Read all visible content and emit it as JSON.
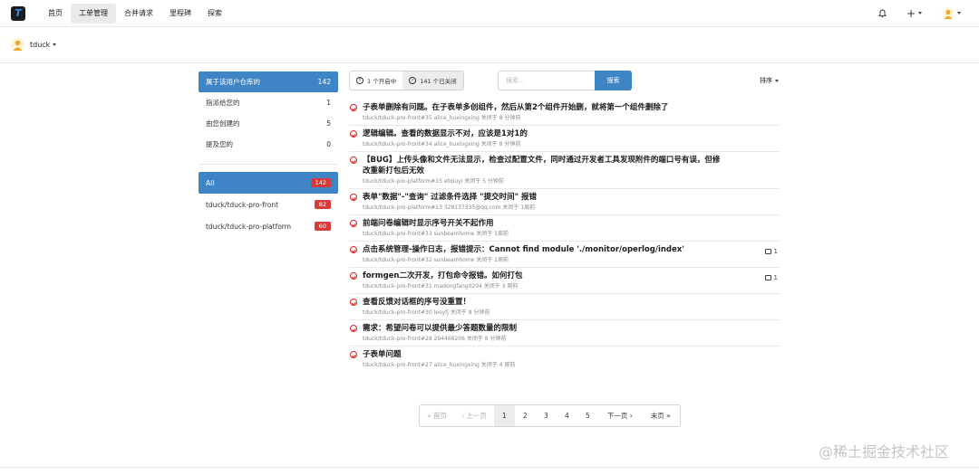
{
  "nav": {
    "logo": "T",
    "links": [
      "首页",
      "工单管理",
      "合并请求",
      "里程碑",
      "探索"
    ],
    "active_index": 1,
    "plus": "+",
    "icons": [
      "bell-icon",
      "plus-icon",
      "avatar"
    ]
  },
  "org": {
    "name": "tduck"
  },
  "sidebar": {
    "filters": [
      {
        "label": "属于该用户仓库的",
        "count": "142",
        "active": true
      },
      {
        "label": "指派给您的",
        "count": "1"
      },
      {
        "label": "由您创建的",
        "count": "5"
      },
      {
        "label": "提及您的",
        "count": "0"
      }
    ],
    "repos": [
      {
        "label": "All",
        "count": "142",
        "active": true
      },
      {
        "label": "tduck/tduck-pro-front",
        "count": "82"
      },
      {
        "label": "tduck/tduck-pro-platform",
        "count": "60"
      }
    ]
  },
  "toolbar": {
    "open_label": "1 个开启中",
    "closed_label": "141 个已关闭",
    "search_placeholder": "搜索...",
    "search_button": "搜索",
    "sort_label": "排序"
  },
  "issues": [
    {
      "title": "子表单删除有问题。在子表单多创组件，然后从第2个组件开始删，就将第一个组件删除了",
      "meta": "tduck/tduck-pro-front#35  alice_huxingxing 关闭于 8 分钟前",
      "comments": ""
    },
    {
      "title": "逻辑编辑。查看的数据显示不对，应该是1对1的",
      "meta": "tduck/tduck-pro-front#34  alice_huxingxing 关闭于 8 分钟前",
      "comments": ""
    },
    {
      "title": "【BUG】上传头像和文件无法显示，检查过配置文件，同时通过开发者工具发现附件的端口号有误，但修改重新打包后无效",
      "meta": "tduck/tduck-pro-platform#15  etqiuyi 关闭于 5 分钟前",
      "comments": ""
    },
    {
      "title": "表单\"数据\"-\"查询\" 过滤条件选择 \"提交时间\" 报错",
      "meta": "tduck/tduck-pro-platform#13  328137335@qq.com 关闭于 1周前",
      "comments": ""
    },
    {
      "title": "前端问卷编辑时显示序号开关不起作用",
      "meta": "tduck/tduck-pro-front#33  sunbeamhome 关闭于 1周前",
      "comments": ""
    },
    {
      "title": "点击系统管理-操作日志，报错提示：Cannot find module './monitor/operlog/index'",
      "meta": "tduck/tduck-pro-front#32  sunbeamhome 关闭于 1周前",
      "comments": "1"
    },
    {
      "title": "formgen二次开发，打包命令报错。如何打包",
      "meta": "tduck/tduck-pro-front#31  madongfang0204 关闭于 3 周前",
      "comments": "1"
    },
    {
      "title": "查看反馈对话框的序号没重置！",
      "meta": "tduck/tduck-pro-front#30  leoyfj 关闭于 8 分钟前",
      "comments": ""
    },
    {
      "title": "需求：希望问卷可以提供最少答题数量的限制",
      "meta": "tduck/tduck-pro-front#28  294466206 关闭于 8 分钟前",
      "comments": ""
    },
    {
      "title": "子表单问题",
      "meta": "tduck/tduck-pro-front#27  alice_huxingxing 关闭于 4 周前",
      "comments": ""
    }
  ],
  "pagination": {
    "first": "« 首页",
    "prev": "‹ 上一页",
    "pages": [
      "1",
      "2",
      "3",
      "4",
      "5"
    ],
    "active": "1",
    "next": "下一页 ›",
    "last": "末页 »"
  },
  "watermark": "@稀土掘金技术社区"
}
